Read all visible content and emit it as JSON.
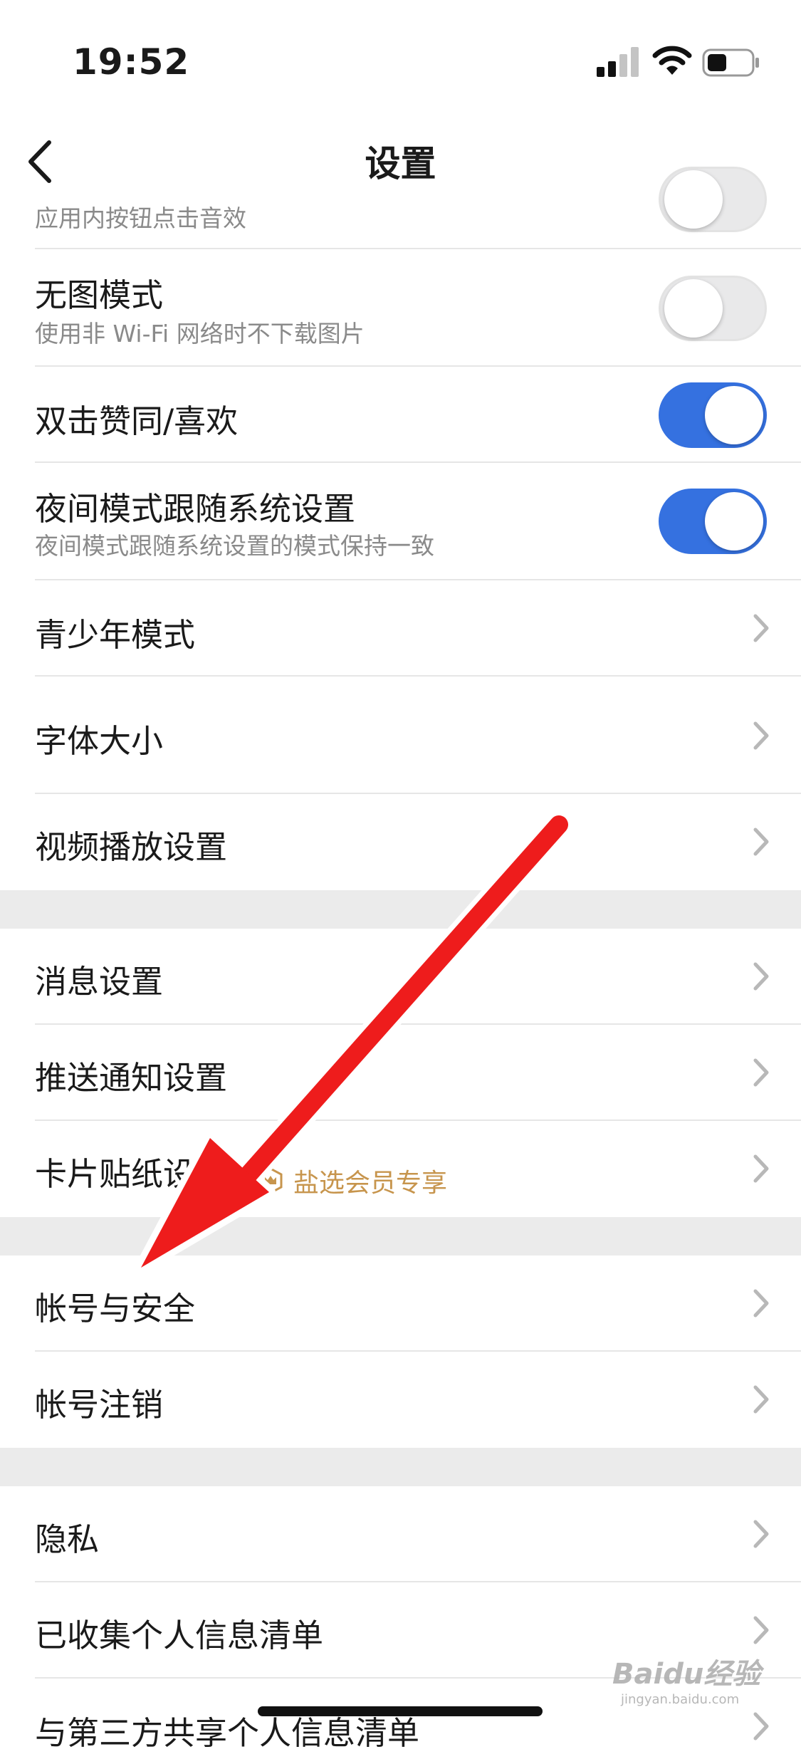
{
  "status_bar": {
    "time": "19:52",
    "signal_icon": "cellular-signal-icon",
    "wifi_icon": "wifi-icon",
    "battery_icon": "battery-icon"
  },
  "nav": {
    "title": "设置",
    "back_icon": "chevron-left-icon"
  },
  "rows": {
    "button_sound": {
      "subtitle": "应用内按钮点击音效",
      "toggle": "off"
    },
    "no_image_mode": {
      "title": "无图模式",
      "subtitle": "使用非 Wi-Fi 网络时不下载图片",
      "toggle": "off"
    },
    "double_tap_like": {
      "title": "双击赞同/喜欢",
      "toggle": "on"
    },
    "night_mode_follow": {
      "title": "夜间模式跟随系统设置",
      "subtitle": "夜间模式跟随系统设置的模式保持一致",
      "toggle": "on"
    },
    "teen_mode": {
      "title": "青少年模式"
    },
    "font_size": {
      "title": "字体大小"
    },
    "video_playback": {
      "title": "视频播放设置"
    },
    "message_settings": {
      "title": "消息设置"
    },
    "push_notifications": {
      "title": "推送通知设置"
    },
    "card_sticker": {
      "title": "卡片贴纸设置",
      "badge": "盐选会员专享",
      "badge_icon": "crown-shield-icon"
    },
    "account_security": {
      "title": "帐号与安全"
    },
    "account_cancel": {
      "title": "帐号注销"
    },
    "privacy": {
      "title": "隐私"
    },
    "collected_info": {
      "title": "已收集个人信息清单"
    },
    "third_party_info": {
      "title": "与第三方共享个人信息清单"
    }
  },
  "colors": {
    "toggle_on": "#3571e0",
    "badge": "#c7954d",
    "annotation_arrow": "#ee1c1c",
    "section_gap": "#ebebeb"
  },
  "watermark": {
    "main": "Baidu经验",
    "sub": "jingyan.baidu.com"
  }
}
